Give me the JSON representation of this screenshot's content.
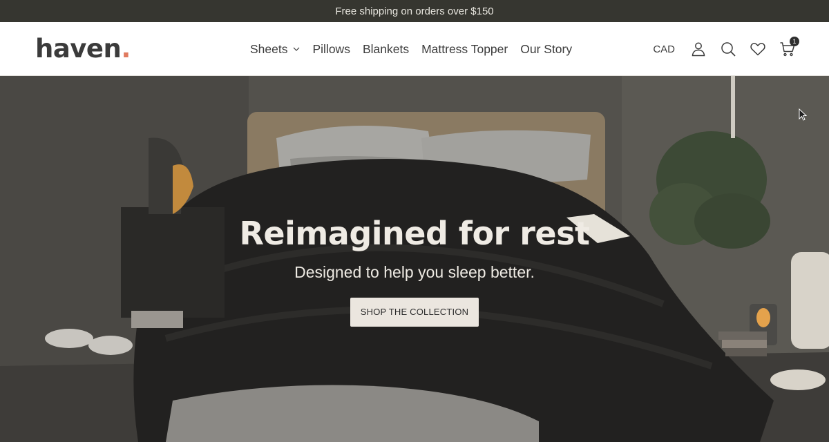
{
  "announcement": {
    "text": "Free shipping on orders over $150"
  },
  "header": {
    "logo_text": "haven",
    "logo_dot": ".",
    "nav": [
      {
        "label": "Sheets",
        "has_dropdown": true
      },
      {
        "label": "Pillows"
      },
      {
        "label": "Blankets"
      },
      {
        "label": "Mattress Topper"
      },
      {
        "label": "Our Story"
      }
    ],
    "currency": "CAD",
    "icons": [
      "account-icon",
      "search-icon",
      "wishlist-icon",
      "cart-icon"
    ],
    "cart_count": "1"
  },
  "hero": {
    "title": "Reimagined for rest",
    "subtitle": "Designed to help you sleep better.",
    "cta_label": "SHOP THE COLLECTION"
  },
  "colors": {
    "announcement_bg": "#363630",
    "accent_dot": "#e07a5f",
    "cta_bg": "#ebe6df"
  }
}
